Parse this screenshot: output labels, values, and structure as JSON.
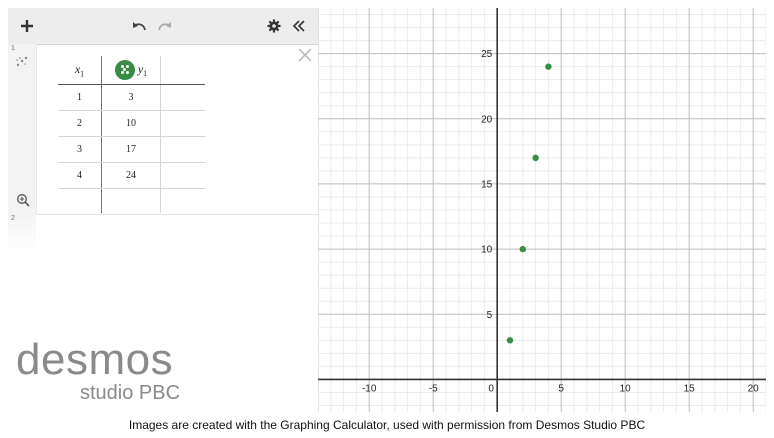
{
  "toolbar": {
    "add_icon": "plus-icon",
    "undo_icon": "undo-icon",
    "redo_icon": "redo-icon",
    "settings_icon": "gear-icon",
    "collapse_icon": "double-chevron-left-icon"
  },
  "expressions": [
    {
      "index": "1",
      "table": {
        "headers": [
          {
            "var": "x",
            "sub": "1"
          },
          {
            "var": "y",
            "sub": "1"
          }
        ],
        "rows": [
          [
            "1",
            "3"
          ],
          [
            "2",
            "10"
          ],
          [
            "3",
            "17"
          ],
          [
            "4",
            "24"
          ]
        ],
        "point_color": "#388c46"
      }
    },
    {
      "index": "2"
    }
  ],
  "logo": {
    "main": "desmos",
    "sub": "studio PBC"
  },
  "chart_data": {
    "type": "scatter",
    "x": [
      1,
      2,
      3,
      4
    ],
    "y": [
      3,
      10,
      17,
      24
    ],
    "xlim": [
      -14,
      21
    ],
    "ylim": [
      -2.5,
      28.5
    ],
    "x_ticks": [
      -10,
      -5,
      0,
      5,
      10,
      15,
      20
    ],
    "y_ticks": [
      5,
      10,
      15,
      20,
      25
    ],
    "grid": true,
    "point_color": "#388c46"
  },
  "caption": "Images are created with the Graphing Calculator, used with permission from Desmos Studio PBC"
}
